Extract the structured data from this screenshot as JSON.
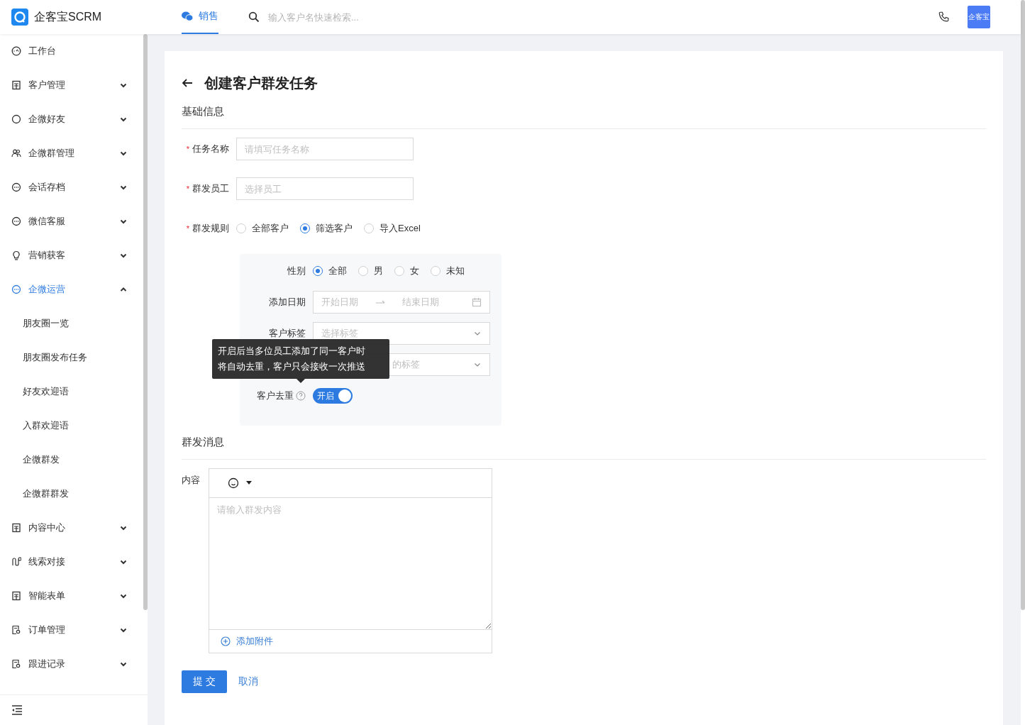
{
  "header": {
    "logo_text": "企客宝SCRM",
    "tabs": [
      {
        "label": "销售",
        "selected": true
      }
    ],
    "search": {
      "placeholder": "输入客户名快速检索..."
    },
    "avatar_text": "企客宝"
  },
  "sidebar": {
    "items": [
      {
        "label": "工作台",
        "kind": "link",
        "selected": false
      },
      {
        "label": "客户管理",
        "kind": "group",
        "expanded": false,
        "selected": false
      },
      {
        "label": "企微好友",
        "kind": "group",
        "expanded": false,
        "selected": false
      },
      {
        "label": "企微群管理",
        "kind": "group",
        "expanded": false,
        "selected": false
      },
      {
        "label": "会话存档",
        "kind": "group",
        "expanded": false,
        "selected": false
      },
      {
        "label": "微信客服",
        "kind": "group",
        "expanded": false,
        "selected": false
      },
      {
        "label": "营销获客",
        "kind": "group",
        "expanded": false,
        "selected": false
      },
      {
        "label": "企微运营",
        "kind": "group",
        "expanded": true,
        "selected": true,
        "children": [
          {
            "label": "朋友圈一览",
            "selected": false
          },
          {
            "label": "朋友圈发布任务",
            "selected": false
          },
          {
            "label": "好友欢迎语",
            "selected": false
          },
          {
            "label": "入群欢迎语",
            "selected": false
          },
          {
            "label": "企微群发",
            "selected": false
          },
          {
            "label": "企微群群发",
            "selected": false
          }
        ]
      },
      {
        "label": "内容中心",
        "kind": "group",
        "expanded": false,
        "selected": false
      },
      {
        "label": "线索对接",
        "kind": "group",
        "expanded": false,
        "selected": false
      },
      {
        "label": "智能表单",
        "kind": "group",
        "expanded": false,
        "selected": false
      },
      {
        "label": "订单管理",
        "kind": "group",
        "expanded": false,
        "selected": false
      },
      {
        "label": "跟进记录",
        "kind": "group",
        "expanded": false,
        "selected": false
      }
    ]
  },
  "page": {
    "title": "创建客户群发任务",
    "basic_section": {
      "title": "基础信息",
      "task_name": {
        "label": "任务名称",
        "required_mark": "*",
        "placeholder": "请填写任务名称"
      },
      "staff": {
        "label": "群发员工",
        "required_mark": "*",
        "placeholder": "选择员工"
      },
      "rule": {
        "label": "群发规则",
        "required_mark": "*",
        "options": [
          {
            "label": "全部客户",
            "selected": false
          },
          {
            "label": "筛选客户",
            "selected": true
          },
          {
            "label": "导入Excel",
            "selected": false
          }
        ]
      },
      "filter": {
        "gender": {
          "label": "性别",
          "options": [
            {
              "label": "全部",
              "selected": true
            },
            {
              "label": "男",
              "selected": false
            },
            {
              "label": "女",
              "selected": false
            },
            {
              "label": "未知",
              "selected": false
            }
          ]
        },
        "date": {
          "label": "添加日期",
          "start_placeholder": "开始日期",
          "end_placeholder": "结束日期"
        },
        "tags": {
          "label": "客户标签",
          "placeholder": "选择标签"
        },
        "exclude_tags": {
          "placeholder": "的标签"
        },
        "dedupe": {
          "label": "客户去重",
          "on": true,
          "switch_text": "开启"
        },
        "tooltip": {
          "lines": [
            "开启后当多位员工添加了同一客户时",
            "将自动去重，客户只会接收一次推送"
          ]
        }
      }
    },
    "message_section": {
      "title": "群发消息",
      "content_label": "内容",
      "placeholder": "请输入群发内容",
      "attach": "添加附件"
    },
    "buttons": {
      "submit": "提 交",
      "cancel": "取消"
    }
  }
}
